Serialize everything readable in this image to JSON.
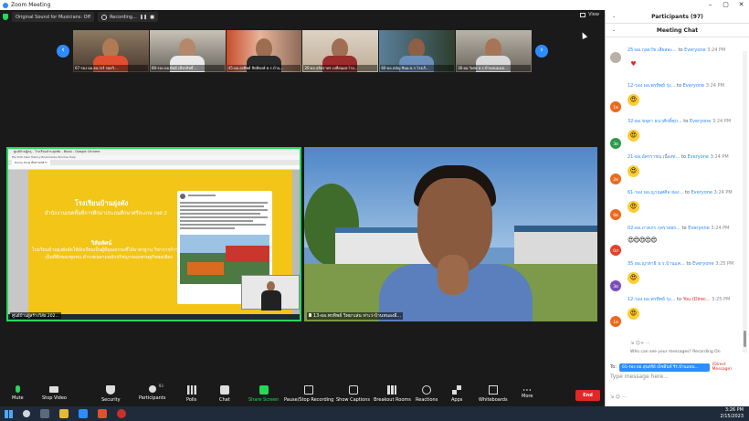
{
  "window": {
    "title": "Zoom Meeting"
  },
  "topbar": {
    "original_sound": "Original Sound for Musicians: Off",
    "recording": "Recording...",
    "view": "View"
  },
  "thumbnails": [
    {
      "name": "67-รอง ผอ.ธนากร์ รอดวิ..."
    },
    {
      "name": "68-รอง ผอ.ทิพย์ เพ็ชรสิทธิ์..."
    },
    {
      "name": "45-ผอ.อรทิพย์ สิทธิพงษ์-ธ.ร.บ้าน..."
    },
    {
      "name": "20-ผอ.สุจิตราพร เปลี่ยนผล-โรง..."
    },
    {
      "name": "60-ผอ.สมัญ สินน-ธ.ร.โรงเรี..."
    },
    {
      "name": "36-ผอ.วิเศษ ธ.ร.บ้านหนองเด..."
    }
  ],
  "share_tile": {
    "window_title": "ศูนย์บ้านผู้ครู - โรงเรียนบ้านยุ่มชัย - ติดต่อ - Google Chrome",
    "menu": "File  Edit  View  History  Bookmarks  Window  Help",
    "tab": "Home   Tools   ค้นหาเอกสาร",
    "slide_title": "โรงเรียนบ้านยุ่งตัง",
    "slide_sub": "สำนักงานเขตพื้นที่การศึกษาประถมศึกษาศรีสะเกษ เขต 2",
    "vision_title": "วิสัยทัศน์",
    "vision_text": "โรงเรียนบ้านยุ่งตังจัดให้นักเรียนเป็นผู้มีคุณธรรมที่ได้มาตรฐาน วิชาการก้าวไกล เป็นที่พึงของชุมชน ดำรงตนตามหลักปรัชญาของเศรษฐกิจพอเพียง",
    "name": "ศูนย์บ้านผู้สร้างวิสัย 202..."
  },
  "speaker_tile": {
    "name": "13-ผอ.พรทิพย์ วิทยาเล่น ท่าเว่-บ้านหนองอี..."
  },
  "toolbar": {
    "mute": "Mute",
    "stop_video": "Stop Video",
    "security": "Security",
    "participants": "Participants",
    "participants_count": "93",
    "polls": "Polls",
    "chat": "Chat",
    "share_screen": "Share Screen",
    "record": "Pause/Stop Recording",
    "captions": "Show Captions",
    "breakout": "Breakout Rooms",
    "reactions": "Reactions",
    "apps": "Apps",
    "whiteboards": "Whiteboards",
    "more": "More",
    "end": "End"
  },
  "panel": {
    "participants_header": "Participants (97)",
    "chat_header": "Meeting Chat"
  },
  "messages": [
    {
      "sender": "25-ผอ.กุลธวัช เสียสละ...",
      "to_word": "to",
      "target": "Everyone",
      "time": "3:24 PM",
      "avatar": "",
      "avatar_color": "#b9b0a8",
      "content": "heart"
    },
    {
      "sender": "12-รอง ผอ.พรทิพย์ รุ่ง...",
      "to_word": "to",
      "target": "Everyone",
      "time": "3:24 PM",
      "avatar": "1ผ",
      "avatar_color": "#ea6a1c",
      "content": "😍"
    },
    {
      "sender": "32-ผอ.ขจุดา ธนาศักดิ์ศุภ...",
      "to_word": "to",
      "target": "Everyone",
      "time": "3:24 PM",
      "avatar": "3ผ",
      "avatar_color": "#2c9a4a",
      "content": "😍"
    },
    {
      "sender": "21-ผอ.อัครราชน เนื่องท...",
      "to_word": "to",
      "target": "Everyone",
      "time": "3:24 PM",
      "avatar": "2ผ",
      "avatar_color": "#ea6a1c",
      "content": "😍"
    },
    {
      "sender": "61-รอง ผอ.ญาณศศิล ย่อง...",
      "to_word": "to",
      "target": "Everyone",
      "time": "3:24 PM",
      "avatar": "6ผ",
      "avatar_color": "#ea6a1c",
      "content": "😍"
    },
    {
      "sender": "02-ผอ.ภาคภร กุลรายพร...",
      "to_word": "to",
      "target": "Everyone",
      "time": "3:24 PM",
      "avatar": "0ภ",
      "avatar_color": "#e0432a",
      "content": "😍😍😍😍😍"
    },
    {
      "sender": "35 ผอ.ญาตาธิ ธ.ร.บ้านแค...",
      "to_word": "to",
      "target": "Everyone",
      "time": "3:25 PM",
      "avatar": "3ผ",
      "avatar_color": "#7c4db8",
      "content": "😍"
    },
    {
      "sender": "12-รอง ผอ.พรทิพย์ รุ่ง...",
      "to_word": "to",
      "target": "You (Direc...",
      "time": "3:25 PM",
      "avatar": "1ผ",
      "avatar_color": "#ea6a1c",
      "content": "😍"
    }
  ],
  "chat_footer": {
    "reactions": "⇲  ☺+  ···",
    "notice": "Who can see your messages? Recording On",
    "to_label": "To:",
    "to_value": "65-รอง ผอ.สุนทรีย์ เพ็ชสินท์ รีร.บ้านแพน...",
    "direct": "(Direct Message)",
    "placeholder": "Type message here...",
    "input_icons": "⇲  ☺  ···"
  },
  "taskbar": {
    "time": "3:26 PM",
    "date": "2/15/2023"
  }
}
